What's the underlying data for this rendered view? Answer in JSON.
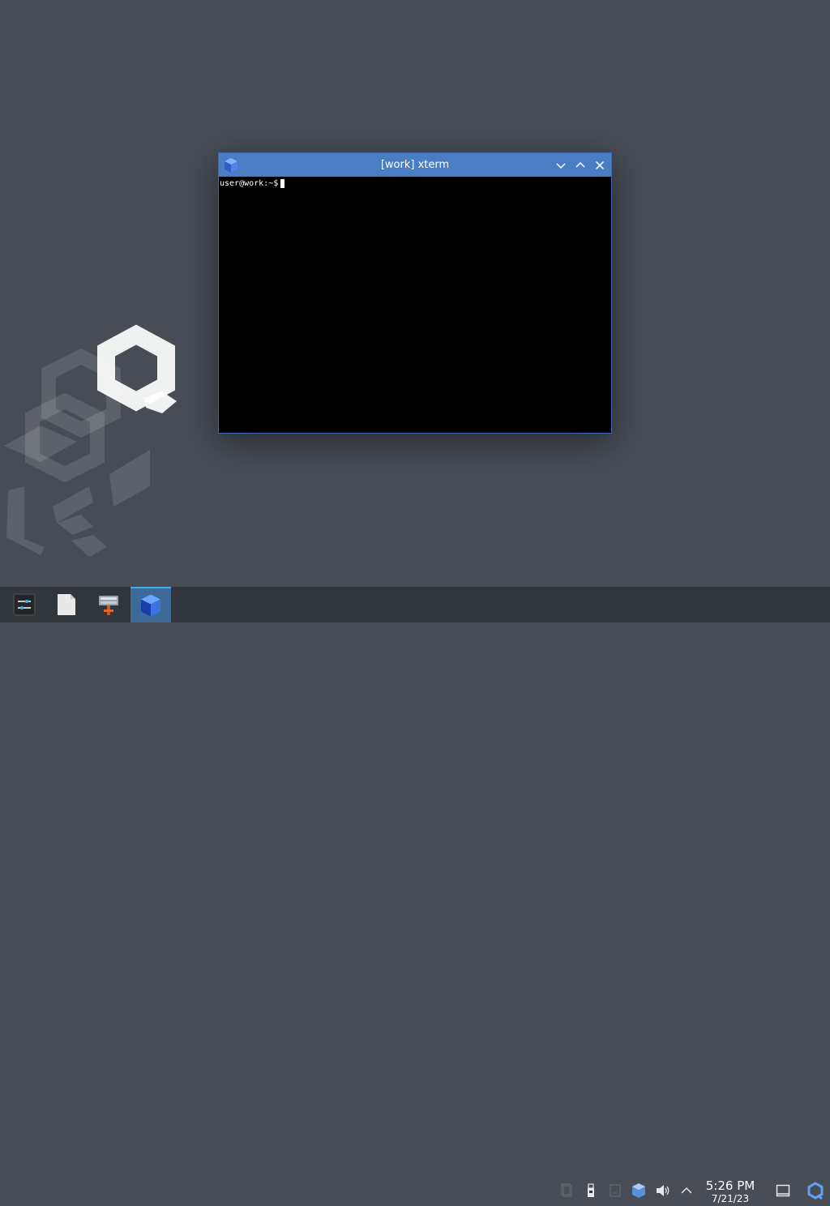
{
  "window": {
    "title": "[work] xterm",
    "prompt": "user@work:~$",
    "titlebar_color": "#4a7ec4"
  },
  "taskbar": {
    "items": [
      {
        "name": "application-menu",
        "icon": "sliders-icon"
      },
      {
        "name": "file-manager",
        "icon": "document-icon"
      },
      {
        "name": "qubes-manager",
        "icon": "qube-manager-icon"
      },
      {
        "name": "xterm-task",
        "icon": "blue-cube-icon",
        "active": true
      }
    ],
    "tray": [
      "clipboard-icon",
      "usb-device-icon",
      "disk-icon",
      "qube-domains-icon",
      "volume-icon",
      "expand-arrow-icon"
    ],
    "clock": {
      "time": "5:26 PM",
      "date": "7/21/23"
    },
    "accent": "#3daee9"
  }
}
